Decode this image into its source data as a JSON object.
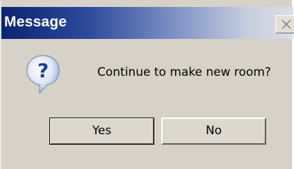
{
  "window": {
    "title": "Message",
    "close_icon": "close-icon"
  },
  "dialog": {
    "icon": "question-icon",
    "message": "Continue to make new room?"
  },
  "buttons": {
    "yes_label": "Yes",
    "no_label": "No"
  },
  "colors": {
    "titlebar_start": "#0b2470",
    "titlebar_end": "#dcdee8",
    "dialog_bg": "#d6d2c8",
    "icon_blue": "#1a3f9c"
  }
}
